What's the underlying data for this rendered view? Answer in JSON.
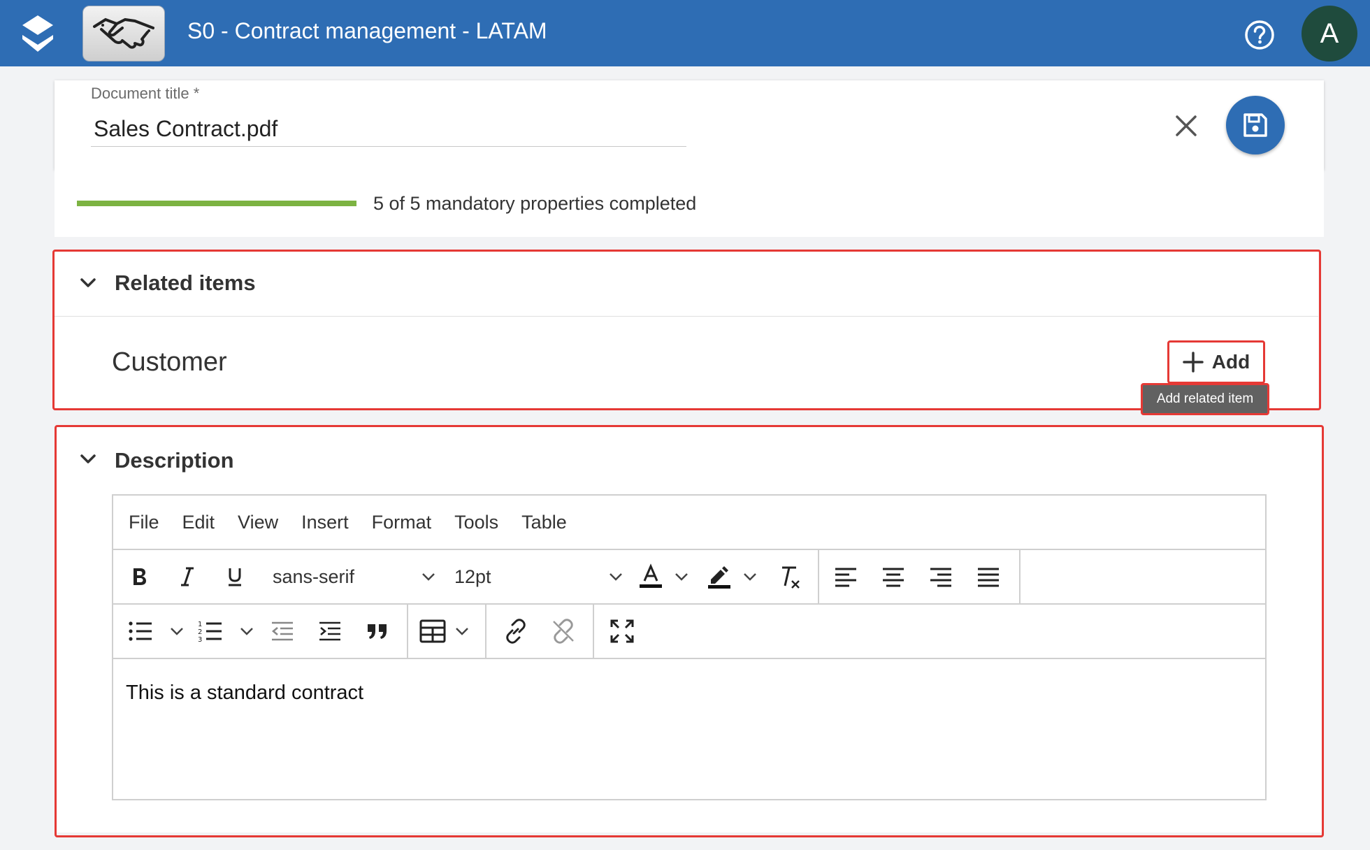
{
  "header": {
    "title": "S0 - Contract management - LATAM",
    "avatar_initial": "A",
    "help_icon": "help-circle-icon",
    "logo_icon": "stacked-layers-logo",
    "thumbnail_icon": "handshake-icon"
  },
  "document": {
    "field_label": "Document title *",
    "title_value": "Sales Contract.pdf",
    "clear_icon": "close-icon",
    "save_icon": "floppy-disk-icon"
  },
  "progress": {
    "completed": 5,
    "total": 5,
    "text": "5 of 5 mandatory properties completed",
    "color": "#7cb342"
  },
  "related_items": {
    "title": "Related items",
    "customer_label": "Customer",
    "add_label": "Add",
    "tooltip": "Add related item"
  },
  "description": {
    "title": "Description",
    "menu": [
      "File",
      "Edit",
      "View",
      "Insert",
      "Format",
      "Tools",
      "Table"
    ],
    "font_family": "sans-serif",
    "font_size": "12pt",
    "content": "This is a standard contract"
  },
  "colors": {
    "header": "#2e6db4",
    "highlight": "#e53935",
    "avatar": "#1f4b3d"
  }
}
